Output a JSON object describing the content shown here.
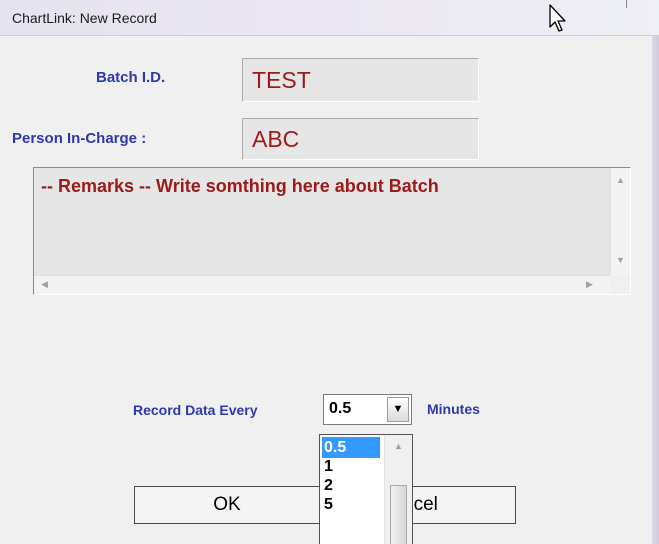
{
  "window": {
    "title": "ChartLink: New Record"
  },
  "form": {
    "batch_id_label": "Batch I.D.",
    "batch_id_value": "TEST",
    "person_label": "Person In-Charge :",
    "person_value": "ABC",
    "remarks_text": "-- Remarks -- Write somthing here about Batch",
    "record_label": "Record Data Every",
    "record_value": "0.5",
    "minutes_label": "Minutes"
  },
  "dropdown": {
    "options": [
      "0.5",
      "1",
      "2",
      "5"
    ],
    "selected_index": 0
  },
  "buttons": {
    "ok": "OK",
    "cancel_partial": "ncel"
  },
  "colors": {
    "label": "#2e39b0",
    "value_text": "#9c1a1a",
    "selection": "#3399ff"
  },
  "icons": {
    "cursor": "mouse-pointer-icon",
    "combo_arrow": "chevron-down-icon"
  }
}
